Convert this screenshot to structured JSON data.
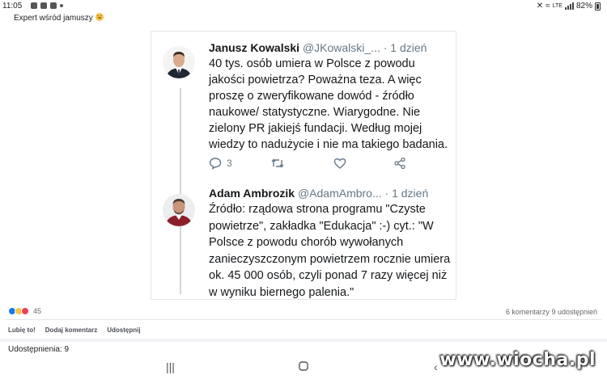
{
  "status_bar": {
    "time": "11:05",
    "battery": "82%",
    "network": "LTE"
  },
  "post": {
    "title": "Expert wśród jamuszy",
    "title_emoji": "laughing-emoji"
  },
  "tweets": [
    {
      "name": "Janusz Kowalski",
      "handle": "@JKowalski_...",
      "time": "· 1 dzień",
      "text": "40 tys. osób umiera w Polsce z powodu jakości powietrza? Poważna teza. A więc proszę o zweryfikowane dowód - źródło naukowe/ statystyczne. Wiarygodne. Nie zielony PR jakiejś fundacji. Według mojej wiedzy to nadużycie i nie ma takiego badania.",
      "reply_count": "3"
    },
    {
      "name": "Adam Ambrozik",
      "handle": "@AdamAmbro...",
      "time": "· 1 dzień",
      "text": "Źródło: rządowa strona programu \"Czyste powietrze\", zakładka \"Edukacja\" :-) cyt.: \"W Polsce z powodu chorób wywołanych zanieczyszczonym powietrzem rocznie umiera ok. 45 000 osób, czyli ponad 7 razy więcej niż w wyniku biernego palenia.\""
    }
  ],
  "reactions": {
    "count": "45",
    "comments": "6 komentarzy",
    "shares_short": "9 udostępnień"
  },
  "actions": {
    "like": "Lubię to!",
    "comment": "Dodaj komentarz",
    "share": "Udostępnij"
  },
  "shares_line": "Udostępnienia: 9",
  "watermark": "www.wiocha.pl",
  "colors": {
    "like_blue": "#1877f2",
    "haha_yellow": "#f7c545",
    "love_red": "#f33e58",
    "twitter_gray": "#657786"
  }
}
